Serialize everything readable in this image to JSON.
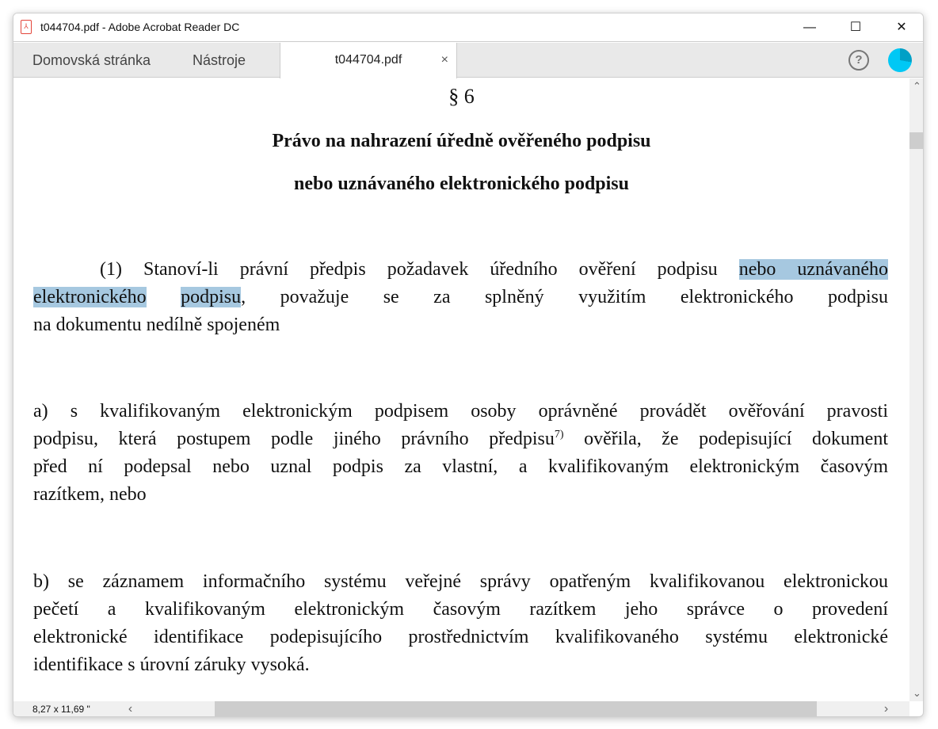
{
  "window": {
    "title": "t044704.pdf - Adobe Acrobat Reader DC",
    "minimize": "—",
    "maximize": "☐",
    "close": "✕"
  },
  "tabs": {
    "home": "Domovská stránka",
    "tools": "Nástroje",
    "document": "t044704.pdf",
    "close": "×"
  },
  "toolbar": {
    "help": "?"
  },
  "document": {
    "section": "§ 6",
    "heading1": "Právo na nahrazení úředně ověřeného podpisu",
    "heading2": "nebo uznávaného elektronického podpisu",
    "p1": {
      "l1a": "(1) Stanoví-li právní předpis požadavek úředního ověření podpisu ",
      "l1hl": "nebo uznávaného",
      "l2hl1": "elektronického",
      "l2sp": " ",
      "l2hl2": "podpisu",
      "l2b": ", považuje se za splněný využitím elektronického podpisu",
      "l3": "na dokumentu nedílně spojeném"
    },
    "pa": {
      "l1": "a) s kvalifikovaným elektronickým podpisem osoby oprávněné provádět ověřování pravosti",
      "l2a": "podpisu, která postupem podle jiného právního předpisu",
      "l2sup": "7)",
      "l2b": " ověřila, že podepisující dokument",
      "l3": "před ní podepsal nebo uznal podpis za vlastní, a kvalifikovaným elektronickým časovým",
      "l4": "razítkem, nebo"
    },
    "pb": {
      "l1": "b) se záznamem informačního systému veřejné správy opatřeným kvalifikovanou elektronickou",
      "l2": "pečetí a kvalifikovaným elektronickým časovým razítkem jeho správce o provedení",
      "l3": "elektronické identifikace podepisujícího prostřednictvím kvalifikovaného systému elektronické",
      "l4": "identifikace s úrovní záruky vysoká."
    }
  },
  "status": {
    "page_size": "8,27 x 11,69 \""
  },
  "scroll": {
    "up": "⌃",
    "down": "⌄",
    "left": "‹",
    "right": "›"
  },
  "colors": {
    "highlight": "#a6c8e0",
    "avatar": "#00c8f5"
  }
}
